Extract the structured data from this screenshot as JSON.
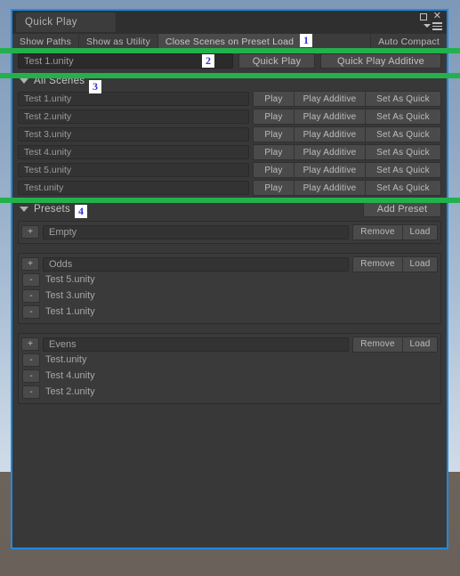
{
  "window": {
    "tab_title": "Quick Play",
    "controls": {
      "maximize": "maximize-icon",
      "close": "✕",
      "menu": "hamburger-menu-icon"
    }
  },
  "toolbar": {
    "show_paths": "Show Paths",
    "show_as_utility": "Show as Utility",
    "close_scenes_on_preset_load": "Close Scenes on Preset Load",
    "auto_compact": "Auto Compact"
  },
  "quick_play": {
    "scene_value": "Test 1.unity",
    "play_button": "Quick Play",
    "play_additive_button": "Quick Play Additive"
  },
  "all_scenes": {
    "header": "All Scenes",
    "actions": {
      "play": "Play",
      "play_additive": "Play Additive",
      "set_as_quick": "Set As Quick"
    },
    "rows": [
      {
        "name": "Test 1.unity"
      },
      {
        "name": "Test 2.unity"
      },
      {
        "name": "Test 3.unity"
      },
      {
        "name": "Test 4.unity"
      },
      {
        "name": "Test 5.unity"
      },
      {
        "name": "Test.unity"
      }
    ]
  },
  "presets": {
    "header": "Presets",
    "add_preset": "Add Preset",
    "add_symbol": "+",
    "remove_symbol": "-",
    "remove_label": "Remove",
    "load_label": "Load",
    "items": [
      {
        "name": "Empty",
        "scenes": []
      },
      {
        "name": "Odds",
        "scenes": [
          "Test 5.unity",
          "Test 3.unity",
          "Test 1.unity"
        ]
      },
      {
        "name": "Evens",
        "scenes": [
          "Test.unity",
          "Test 4.unity",
          "Test 2.unity"
        ]
      }
    ]
  },
  "annotations": {
    "markers": [
      "1",
      "2",
      "3",
      "4"
    ],
    "band_color": "#22b14c",
    "marker_color": "#3333cc"
  }
}
